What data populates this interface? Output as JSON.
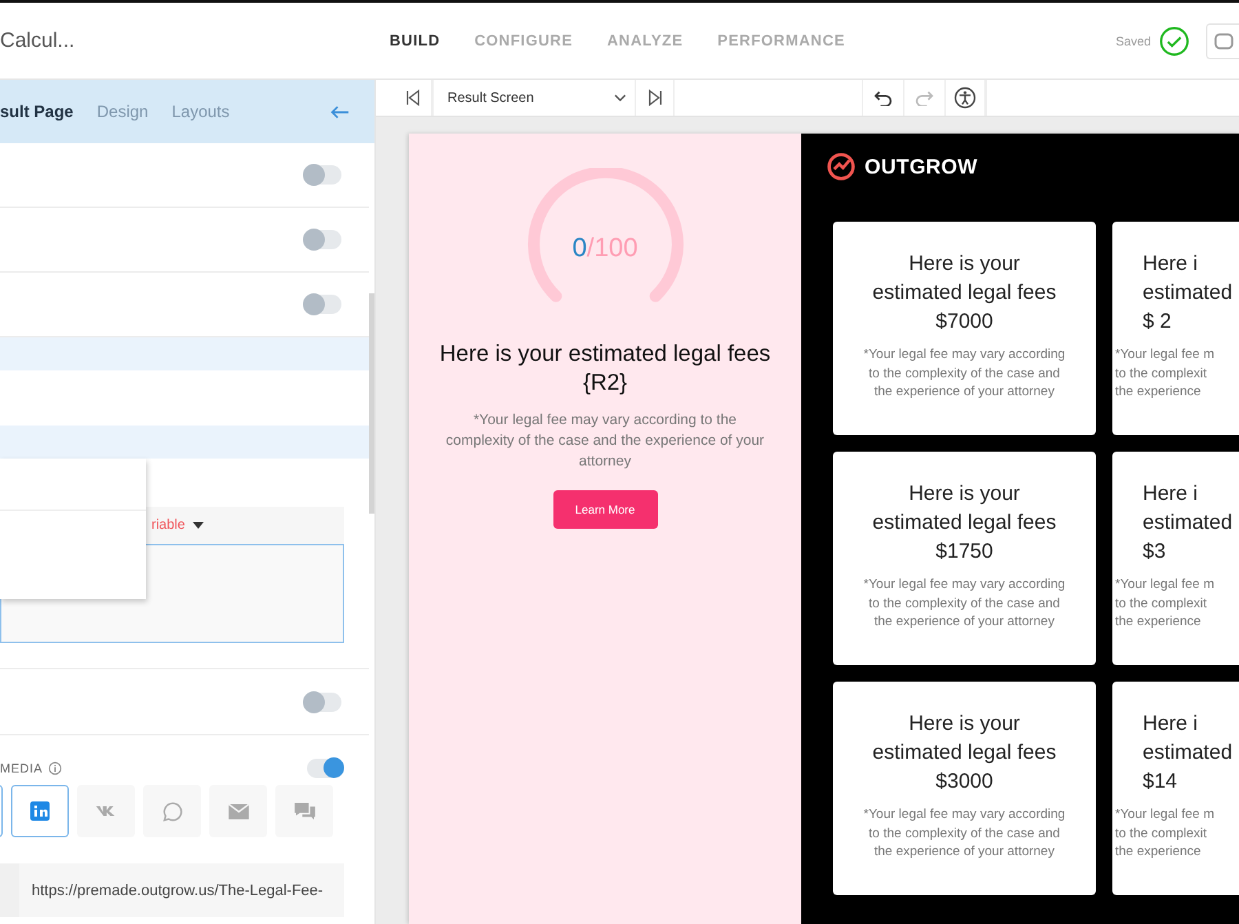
{
  "app_title": "Calcul...",
  "nav_tabs": [
    {
      "label": "BUILD",
      "selected": true
    },
    {
      "label": "CONFIGURE",
      "selected": false
    },
    {
      "label": "ANALYZE",
      "selected": false
    },
    {
      "label": "PERFORMANCE",
      "selected": false
    }
  ],
  "save_status": "Saved",
  "panel_tabs": [
    {
      "label": "sult Page",
      "selected": true
    },
    {
      "label": "Design",
      "selected": false
    },
    {
      "label": "Layouts",
      "selected": false
    }
  ],
  "toggles": [
    {
      "on": false
    },
    {
      "on": false
    },
    {
      "on": false
    }
  ],
  "variable_label": "riable",
  "lower_toggle": {
    "on": false
  },
  "share": {
    "label": "MEDIA",
    "on": true,
    "buttons": [
      {
        "kind": "generic",
        "selected": true
      },
      {
        "kind": "linkedin",
        "selected": true
      },
      {
        "kind": "vk",
        "selected": false
      },
      {
        "kind": "whatsapp",
        "selected": false
      },
      {
        "kind": "email",
        "selected": false
      },
      {
        "kind": "chat",
        "selected": false
      }
    ]
  },
  "url_field": {
    "value": "https://premade.outgrow.us/The-Legal-Fee-"
  },
  "toolbar": {
    "screen": "Result Screen"
  },
  "preview": {
    "gauge_value": "0",
    "gauge_total": "/100",
    "heading": "Here is your estimated legal fees {R2}",
    "note": "*Your legal fee may vary according to the complexity of the case and the experience of your attorney",
    "button": "Learn More",
    "brand": "OUTGROW",
    "cards": [
      {
        "title_lines": [
          "Here is your",
          "estimated legal fees"
        ],
        "amount": "$7000",
        "note_lines": [
          "*Your legal fee may vary according",
          "to the complexity of the case and",
          "the experience of your attorney"
        ]
      },
      {
        "title_lines": [
          "Here i",
          "estimated"
        ],
        "amount": "$ 2",
        "note_lines": [
          "*Your legal fee m",
          "to the complexit",
          "the experience"
        ]
      },
      {
        "title_lines": [
          "Here is your",
          "estimated legal fees"
        ],
        "amount": "$1750",
        "note_lines": [
          "*Your legal fee may vary according",
          "to the complexity of the case and",
          "the experience of your attorney"
        ]
      },
      {
        "title_lines": [
          "Here i",
          "estimated"
        ],
        "amount": "$3",
        "note_lines": [
          "*Your legal fee m",
          "to the complexit",
          "the experience"
        ]
      },
      {
        "title_lines": [
          "Here is your",
          "estimated legal fees"
        ],
        "amount": "$3000",
        "note_lines": [
          "*Your legal fee may vary according",
          "to the complexity of the case and",
          "the experience of your attorney"
        ]
      },
      {
        "title_lines": [
          "Here i",
          "estimated"
        ],
        "amount": "$14",
        "note_lines": [
          "*Your legal fee m",
          "to the complexit",
          "the experience"
        ]
      }
    ]
  }
}
